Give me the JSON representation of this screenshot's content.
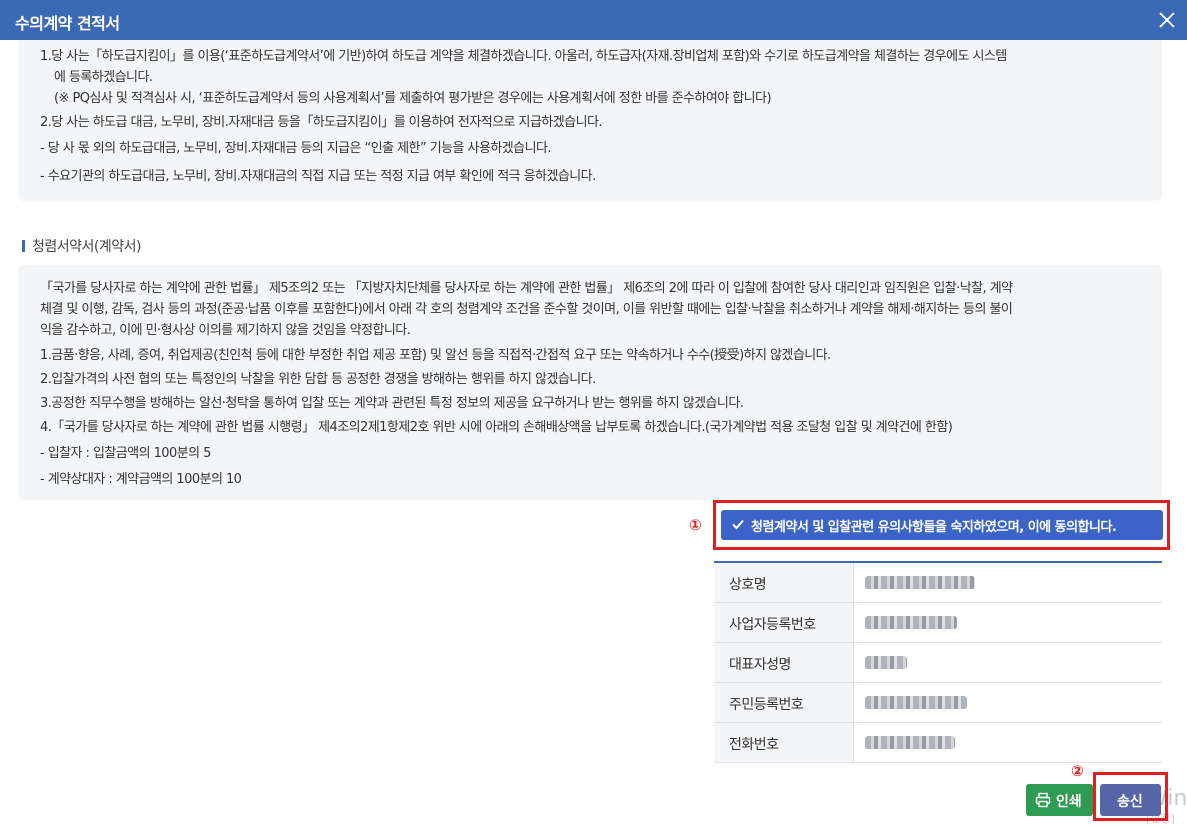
{
  "window": {
    "title": "수의계약 견적서"
  },
  "pledge": {
    "lines": [
      "1.당 사는「하도급지킴이」를 이용(‘표준하도급계약서’에 기반)하여 하도급 계약을 체결하겠습니다. 아울러, 하도급자(자재.장비업체 포함)와 수기로 하도급계약을 체결하는 경우에도 시스템",
      "에 등록하겠습니다.",
      "(※ PQ심사 및 적격심사 시, ‘표준하도급계약서 등의 사용계획서’를 제출하여 평가받은 경우에는 사용계획서에 정한 바를 준수하여야 합니다)",
      "2.당 사는 하도급 대금, 노무비, 장비.자재대금 등을「하도급지킴이」를 이용하여 전자적으로 지급하겠습니다.",
      "- 당 사 몫 외의 하도급대금, 노무비, 장비.자재대금 등의 지급은 “인출 제한” 기능을 사용하겠습니다.",
      "- 수요기관의 하도급대금, 노무비, 장비.자재대금의 직접 지급 또는 적정 지급 여부 확인에 적극 응하겠습니다."
    ]
  },
  "integrity": {
    "section_title": "청렴서약서(계약서)",
    "lines": [
      "「국가를 당사자로 하는 계약에 관한 법률」 제5조의2 또는 「지방자치단체를 당사자로 하는 계약에 관한 법률」 제6조의 2에 따라 이 입찰에 참여한 당사 대리인과 임직원은 입찰·낙찰, 계약",
      "체결 및 이행, 감독, 검사 등의 과정(준공·납품 이후를 포함한다)에서 아래 각 호의 청렴계약 조건을 준수할 것이며, 이를 위반할 때에는 입찰·낙찰을 취소하거나 계약을 해제·해지하는 등의 불이",
      "익을 감수하고, 이에 민·형사상 이의를 제기하지 않을 것임을 약정합니다.",
      "1.금품·향응, 사례, 증여, 취업제공(친인척 등에 대한 부정한 취업 제공 포함) 및 알선 등을 직접적·간접적 요구 또는 약속하거나 수수(授受)하지 않겠습니다.",
      "2.입찰가격의 사전 협의 또는 특정인의 낙찰을 위한 담합 등 공정한 경쟁을 방해하는 행위를 하지 않겠습니다.",
      "3.공정한 직무수행을 방해하는 알선·청탁을 통하여 입찰 또는 계약과 관련된 특정 정보의 제공을 요구하거나 받는 행위를 하지 않겠습니다.",
      "4.「국가를 당사자로 하는 계약에 관한 법률 시행령」 제4조의2제1항제2호 위반 시에 아래의 손해배상액을 납부토록 하겠습니다.(국가계약법 적용 조달청 입찰 및 계약건에 한함)",
      "- 입찰자 : 입찰금액의 100분의 5",
      "- 계약상대자 : 계약금액의 100분의 10"
    ]
  },
  "annotations": {
    "marker1": "①",
    "marker2": "②"
  },
  "agree_button": {
    "label": "청렴계약서 및 입찰관련 유의사항들을 숙지하였으며, 이에 동의합니다.",
    "icon": "check-icon"
  },
  "info_table": {
    "rows": [
      {
        "label": "상호명"
      },
      {
        "label": "사업자등록번호"
      },
      {
        "label": "대표자성명"
      },
      {
        "label": "주민등록번호"
      },
      {
        "label": "전화번호"
      }
    ]
  },
  "buttons": {
    "print_label": "인쇄",
    "print_icon": "printer-icon",
    "send_label": "송신"
  },
  "watermark": {
    "line1": "Wind",
    "line2": "[설정]"
  },
  "colors": {
    "header": "#3b69b3",
    "agree": "#3c64c8",
    "print": "#2e9a52",
    "send": "#5565a8",
    "highlight": "#e02020"
  }
}
